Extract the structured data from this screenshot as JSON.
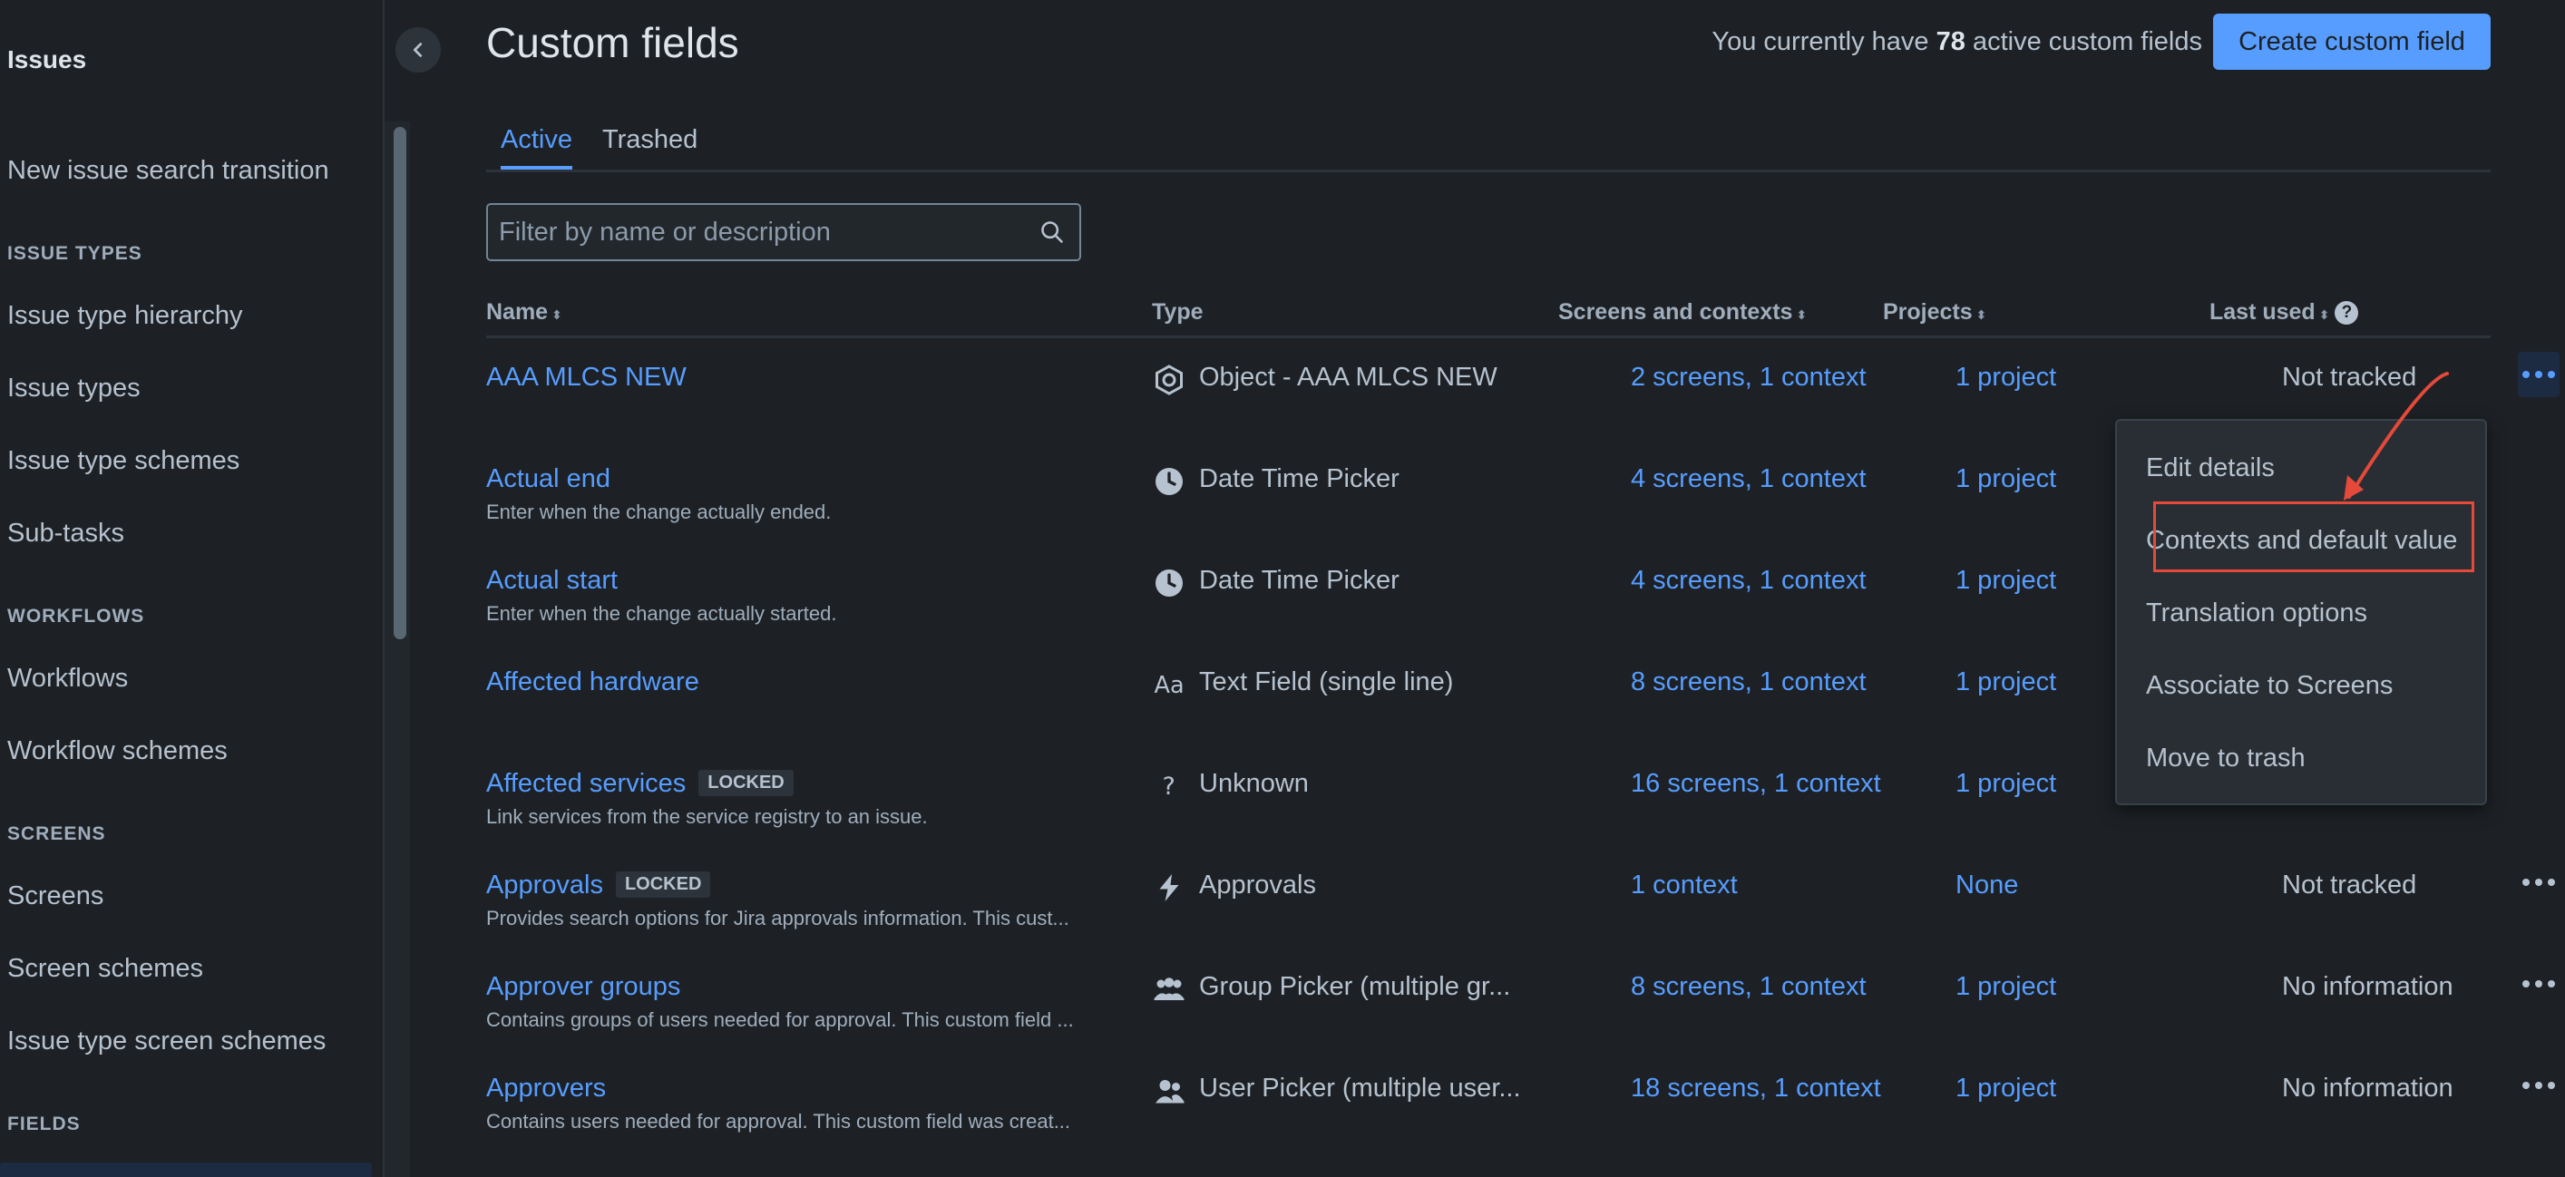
{
  "sidebar": {
    "title": "Issues",
    "items": [
      {
        "label": "New issue search transition",
        "type": "item"
      },
      {
        "label": "ISSUE TYPES",
        "type": "heading"
      },
      {
        "label": "Issue type hierarchy",
        "type": "item"
      },
      {
        "label": "Issue types",
        "type": "item"
      },
      {
        "label": "Issue type schemes",
        "type": "item"
      },
      {
        "label": "Sub-tasks",
        "type": "item"
      },
      {
        "label": "WORKFLOWS",
        "type": "heading"
      },
      {
        "label": "Workflows",
        "type": "item"
      },
      {
        "label": "Workflow schemes",
        "type": "item"
      },
      {
        "label": "SCREENS",
        "type": "heading"
      },
      {
        "label": "Screens",
        "type": "item"
      },
      {
        "label": "Screen schemes",
        "type": "item"
      },
      {
        "label": "Issue type screen schemes",
        "type": "item"
      },
      {
        "label": "FIELDS",
        "type": "heading"
      }
    ]
  },
  "header": {
    "title": "Custom fields",
    "count_prefix": "You currently have ",
    "count": "78",
    "count_suffix": " active custom fields",
    "create_label": "Create custom field"
  },
  "tabs": [
    {
      "label": "Active",
      "active": true
    },
    {
      "label": "Trashed",
      "active": false
    }
  ],
  "filter": {
    "placeholder": "Filter by name or description"
  },
  "columns": {
    "name": "Name",
    "type": "Type",
    "screens": "Screens and contexts",
    "projects": "Projects",
    "last_used": "Last used"
  },
  "rows": [
    {
      "name": "AAA MLCS NEW",
      "badge": "",
      "desc": "",
      "type_icon": "object-icon",
      "type": "Object - AAA MLCS NEW",
      "screens": "2 screens, 1 context",
      "projects": "1 project",
      "last_used": "Not tracked",
      "menu_open": true
    },
    {
      "name": "Actual end",
      "badge": "",
      "desc": "Enter when the change actually ended.",
      "type_icon": "clock-icon",
      "type": "Date Time Picker",
      "screens": "4 screens, 1 context",
      "projects": "1 project",
      "last_used": "",
      "menu_open": false
    },
    {
      "name": "Actual start",
      "badge": "",
      "desc": "Enter when the change actually started.",
      "type_icon": "clock-icon",
      "type": "Date Time Picker",
      "screens": "4 screens, 1 context",
      "projects": "1 project",
      "last_used": "",
      "menu_open": false
    },
    {
      "name": "Affected hardware",
      "badge": "",
      "desc": "",
      "type_icon": "text-field-icon",
      "type": "Text Field (single line)",
      "screens": "8 screens, 1 context",
      "projects": "1 project",
      "last_used": "",
      "menu_open": false
    },
    {
      "name": "Affected services",
      "badge": "LOCKED",
      "desc": "Link services from the service registry to an issue.",
      "type_icon": "question-icon",
      "type": "Unknown",
      "screens": "16 screens, 1 context",
      "projects": "1 project",
      "last_used": "",
      "menu_open": false
    },
    {
      "name": "Approvals",
      "badge": "LOCKED",
      "desc": "Provides search options for Jira approvals information. This cust...",
      "type_icon": "lightning-icon",
      "type": "Approvals",
      "screens": "1 context",
      "projects": "None",
      "last_used": "Not tracked",
      "menu_open": false
    },
    {
      "name": "Approver groups",
      "badge": "",
      "desc": "Contains groups of users needed for approval. This custom field ...",
      "type_icon": "group-icon",
      "type": "Group Picker (multiple gr...",
      "screens": "8 screens, 1 context",
      "projects": "1 project",
      "last_used": "No information",
      "menu_open": false
    },
    {
      "name": "Approvers",
      "badge": "",
      "desc": "Contains users needed for approval. This custom field was creat...",
      "type_icon": "users-icon",
      "type": "User Picker (multiple user...",
      "screens": "18 screens, 1 context",
      "projects": "1 project",
      "last_used": "No information",
      "menu_open": false
    }
  ],
  "dropdown": {
    "items": [
      "Edit details",
      "Contexts and default value",
      "Translation options",
      "Associate to Screens",
      "Move to trash"
    ]
  },
  "colors": {
    "accent": "#579dff",
    "background": "#1d2125",
    "annotation": "#e5493a"
  }
}
